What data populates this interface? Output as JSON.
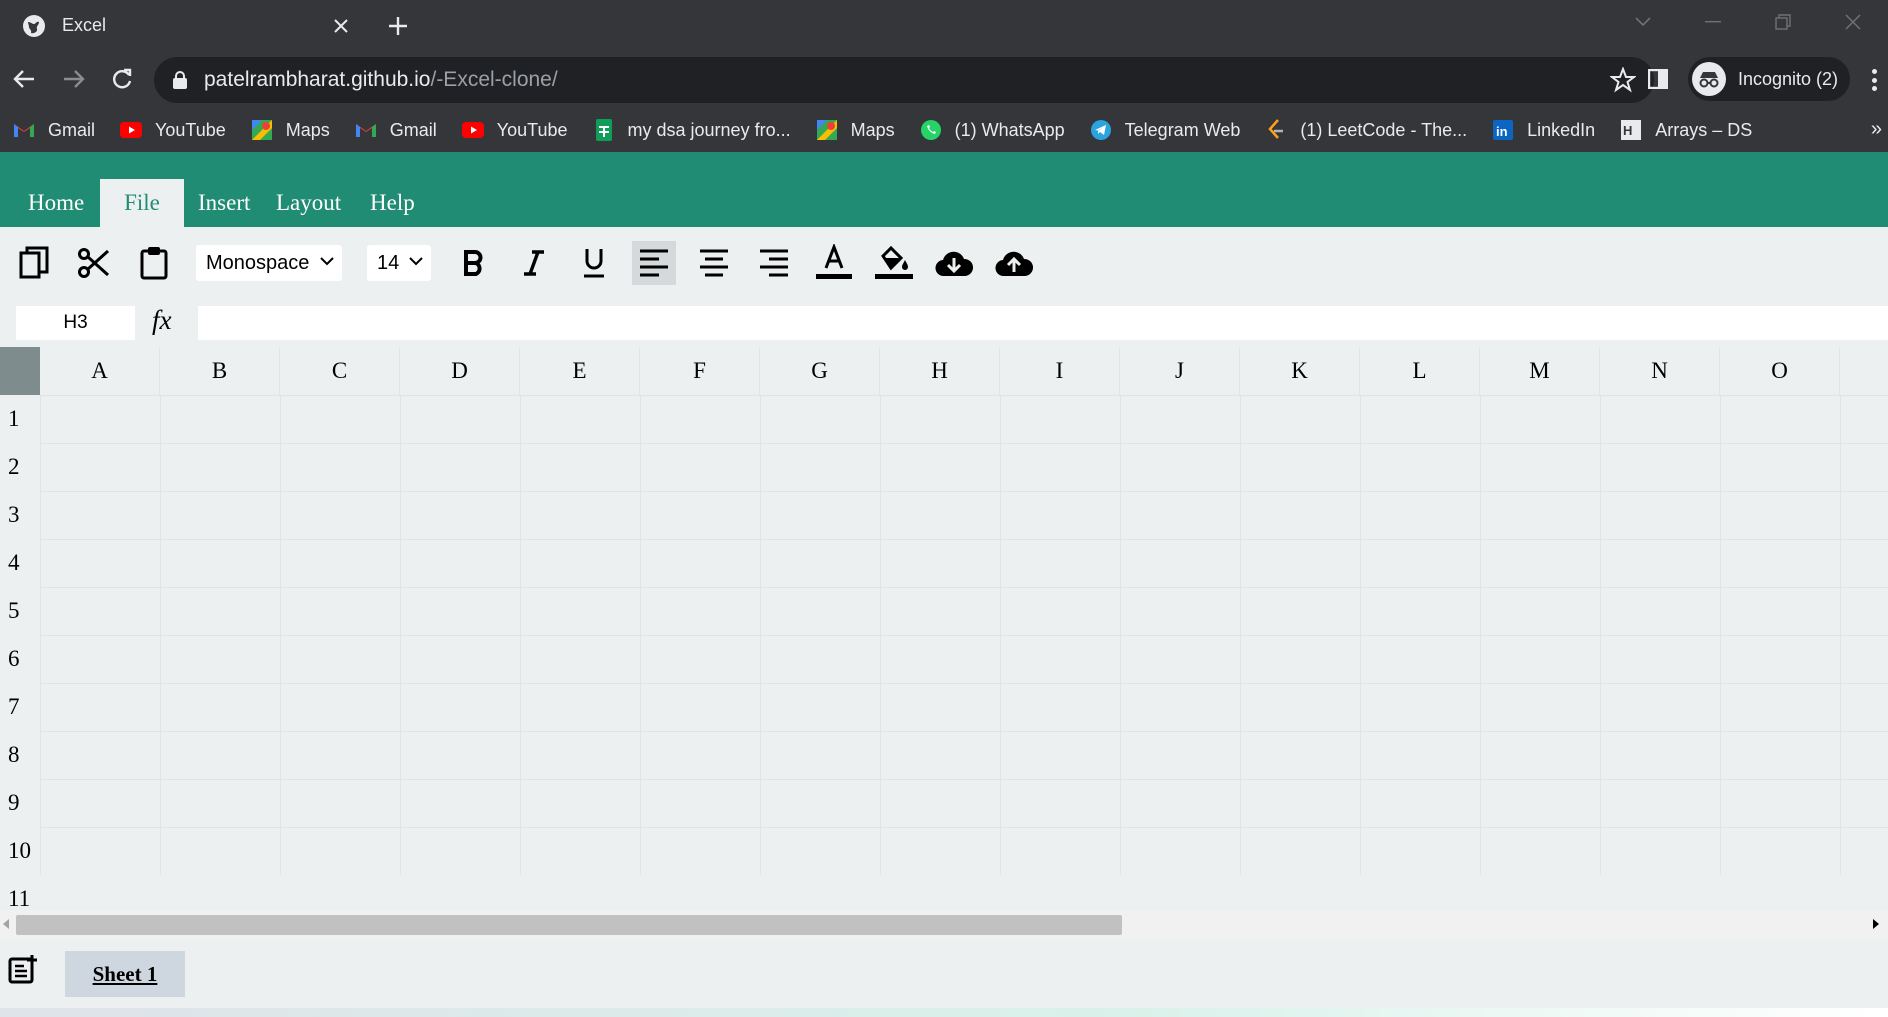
{
  "browser": {
    "tab_title": "Excel",
    "url_host": "patelrambharat.github.io",
    "url_path": "/-Excel-clone/",
    "profile_label": "Incognito (2)",
    "bookmarks": [
      {
        "label": "Gmail",
        "icon": "gmail-icon"
      },
      {
        "label": "YouTube",
        "icon": "youtube-icon"
      },
      {
        "label": "Maps",
        "icon": "maps-icon"
      },
      {
        "label": "Gmail",
        "icon": "gmail-icon"
      },
      {
        "label": "YouTube",
        "icon": "youtube-icon"
      },
      {
        "label": "my dsa journey fro...",
        "icon": "sheets-icon"
      },
      {
        "label": "Maps",
        "icon": "maps-icon"
      },
      {
        "label": "(1) WhatsApp",
        "icon": "whatsapp-icon"
      },
      {
        "label": "Telegram Web",
        "icon": "telegram-icon"
      },
      {
        "label": "(1) LeetCode - The...",
        "icon": "leetcode-icon"
      },
      {
        "label": "LinkedIn",
        "icon": "linkedin-icon"
      },
      {
        "label": "Arrays – DS",
        "icon": "hackerrank-icon"
      }
    ],
    "bookmarks_more": "»"
  },
  "app": {
    "menu": [
      {
        "label": "Home",
        "active": false
      },
      {
        "label": "File",
        "active": true
      },
      {
        "label": "Insert",
        "active": false
      },
      {
        "label": "Layout",
        "active": false
      },
      {
        "label": "Help",
        "active": false
      }
    ],
    "toolbar": {
      "font_family": "Monospace",
      "font_size": "14",
      "tools": [
        "copy-icon",
        "cut-icon",
        "paste-icon",
        "bold-icon",
        "italic-icon",
        "underline-icon",
        "align-left-icon",
        "align-center-icon",
        "align-right-icon",
        "text-color-icon",
        "fill-color-icon",
        "download-icon",
        "upload-icon"
      ],
      "active_tool": "align-left-icon"
    },
    "formula_bar": {
      "cell_address": "H3",
      "fx_label": "fx",
      "formula": ""
    },
    "grid": {
      "columns": [
        "A",
        "B",
        "C",
        "D",
        "E",
        "F",
        "G",
        "H",
        "I",
        "J",
        "K",
        "L",
        "M",
        "N",
        "O"
      ],
      "rows": [
        "1",
        "2",
        "3",
        "4",
        "5",
        "6",
        "7",
        "8",
        "9",
        "10",
        "11"
      ]
    },
    "sheets": [
      {
        "label": "Sheet 1",
        "active": true
      }
    ]
  },
  "colors": {
    "brand_green": "#218c74",
    "workspace": "#ecf0f1",
    "chrome_dark": "#35363a"
  }
}
